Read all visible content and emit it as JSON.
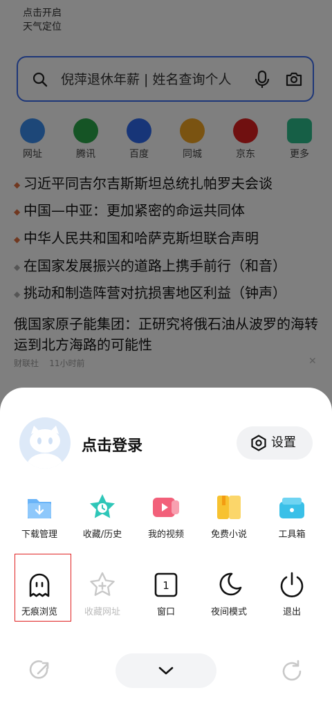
{
  "weather": {
    "line1": "点击开启",
    "line2": "天气定位"
  },
  "search": {
    "text": "倪萍退休年薪 | 姓名查询个人"
  },
  "quick_links": [
    {
      "label": "网址",
      "icon": "globe-icon",
      "color": "#3a8ef0"
    },
    {
      "label": "腾讯",
      "icon": "tencent-icon",
      "color": "#2aa84a"
    },
    {
      "label": "百度",
      "icon": "baidu-paw-icon",
      "color": "#2e6bf0"
    },
    {
      "label": "同城",
      "icon": "58-icon",
      "color": "#f5a623"
    },
    {
      "label": "京东",
      "icon": "jd-dog-icon",
      "color": "#e02020"
    },
    {
      "label": "更多",
      "icon": "layers-icon",
      "color": "#2dbf8c"
    }
  ],
  "news": [
    {
      "text": "习近平同吉尔吉斯斯坦总统扎帕罗夫会谈"
    },
    {
      "text": "中国—中亚：更加紧密的命运共同体"
    },
    {
      "text": "中华人民共和国和哈萨克斯坦联合声明"
    },
    {
      "text": "在国家发展振兴的道路上携手前行（和音）"
    },
    {
      "text": "挑动和制造阵营对抗损害地区利益（钟声）"
    }
  ],
  "article": {
    "title": "俄国家原子能集团：正研究将俄石油从波罗的海转运到北方海路的可能性",
    "source": "财联社",
    "time": "11小时前",
    "close": "✕"
  },
  "sheet": {
    "login": "点击登录",
    "settings": "设置",
    "row1": [
      {
        "label": "下载管理",
        "icon": "download-folder-icon"
      },
      {
        "label": "收藏/历史",
        "icon": "star-clock-icon"
      },
      {
        "label": "我的视频",
        "icon": "video-icon"
      },
      {
        "label": "免费小说",
        "icon": "book-icon"
      },
      {
        "label": "工具箱",
        "icon": "toolbox-icon"
      }
    ],
    "row2": [
      {
        "label": "无痕浏览",
        "icon": "ghost-icon"
      },
      {
        "label": "收藏网址",
        "icon": "star-plus-icon"
      },
      {
        "label": "窗口",
        "icon": "window-count-icon",
        "count": "1"
      },
      {
        "label": "夜间模式",
        "icon": "moon-icon"
      },
      {
        "label": "退出",
        "icon": "power-icon"
      }
    ]
  }
}
